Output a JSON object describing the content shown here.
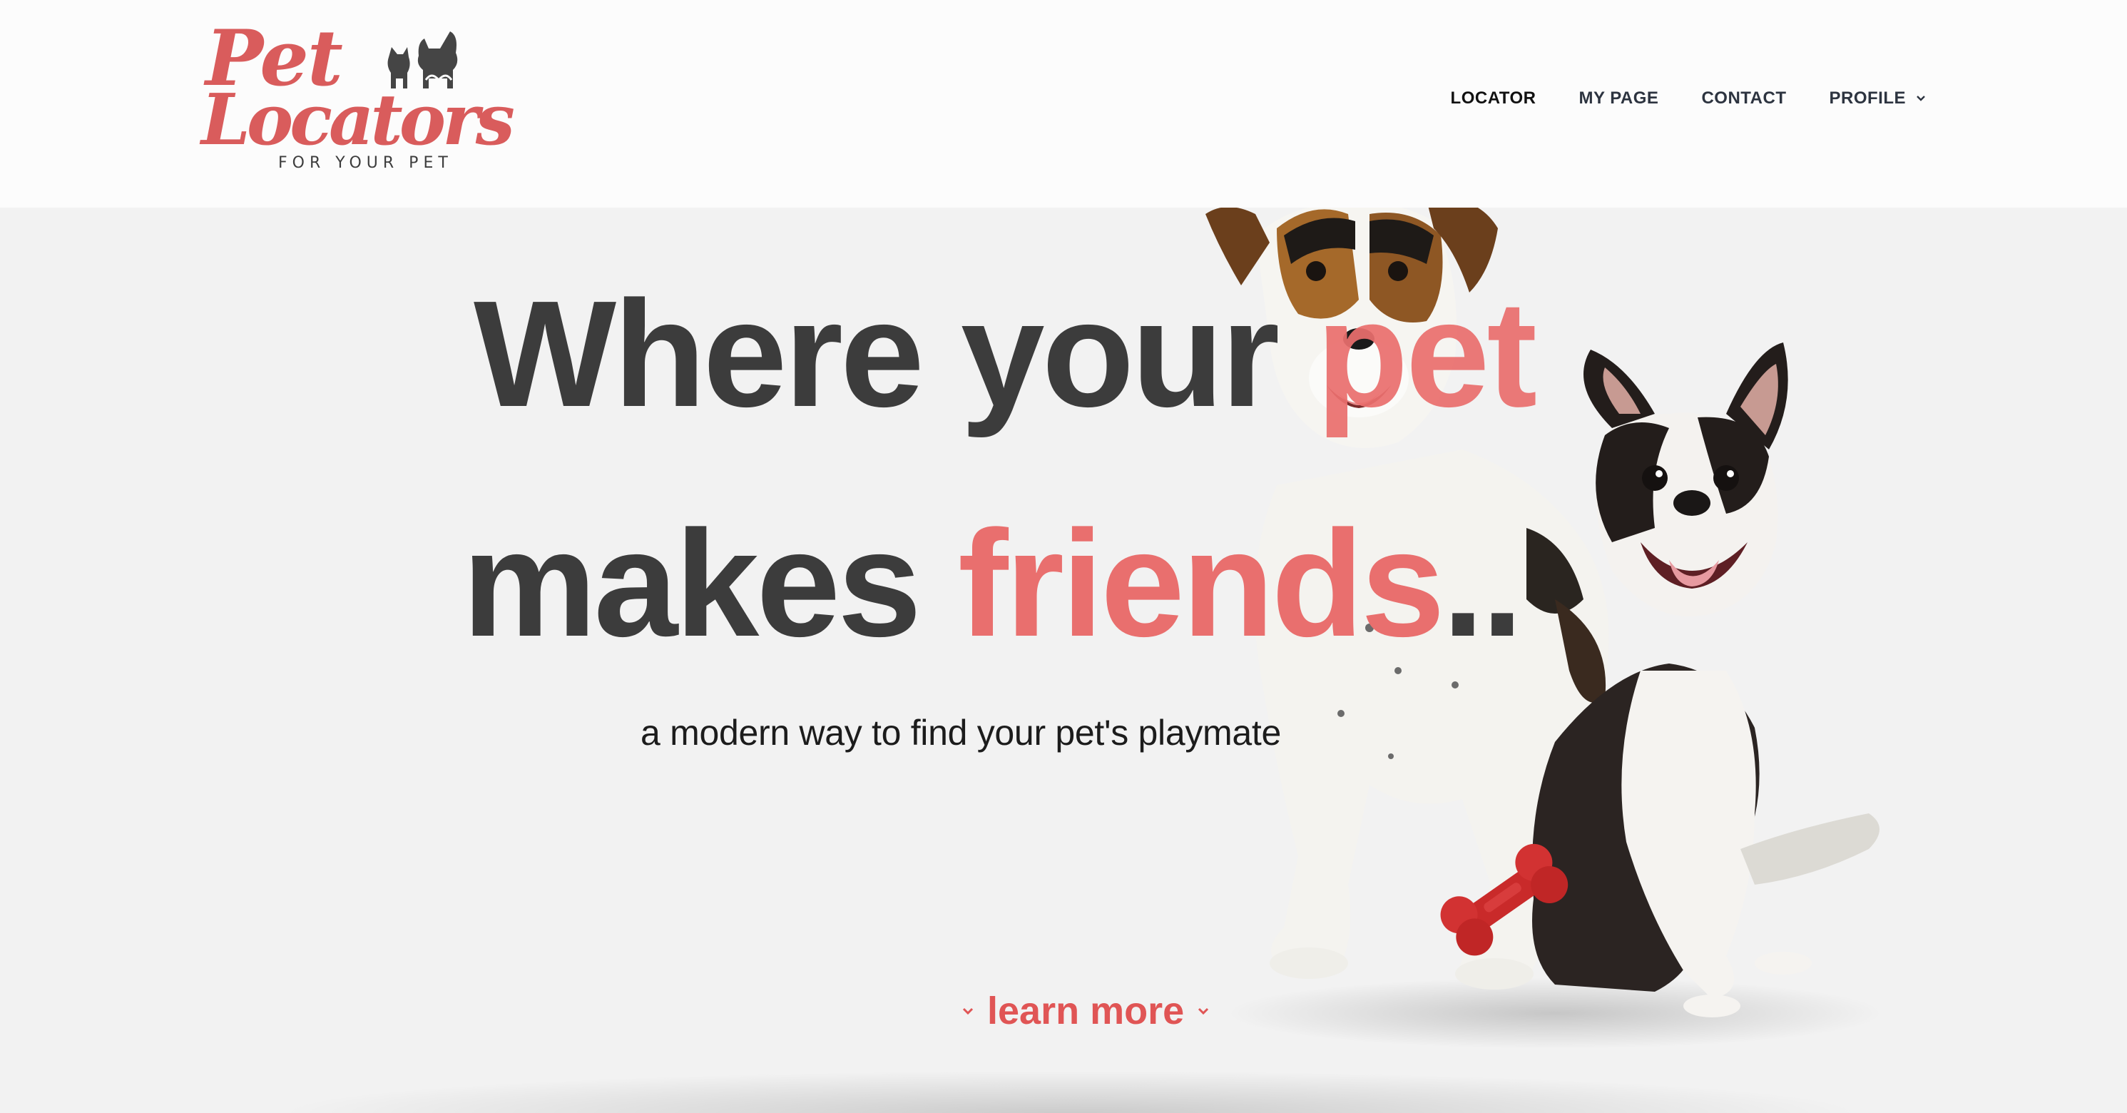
{
  "logo": {
    "line1": "Pet",
    "line2": "Locators",
    "tagline": "FOR YOUR PET",
    "icon": "cat-and-dog-icon"
  },
  "nav": {
    "items": [
      {
        "label": "LOCATOR",
        "active": true
      },
      {
        "label": "MY PAGE",
        "active": false
      },
      {
        "label": "CONTACT",
        "active": false
      },
      {
        "label": "PROFILE",
        "active": false,
        "has_dropdown": true
      }
    ]
  },
  "hero": {
    "line1_a": "Where your ",
    "line1_b": "pet",
    "line2_a": "makes ",
    "line2_b": "friends",
    "line2_c": "..",
    "subtitle": "a modern way to find your pet's playmate",
    "cta": "learn more",
    "image": "two-dogs-with-red-bone-toy"
  },
  "colors": {
    "accent": "#e96f6e",
    "cta": "#e05555",
    "heading": "#3c3c3c",
    "background": "#f2f2f2"
  }
}
